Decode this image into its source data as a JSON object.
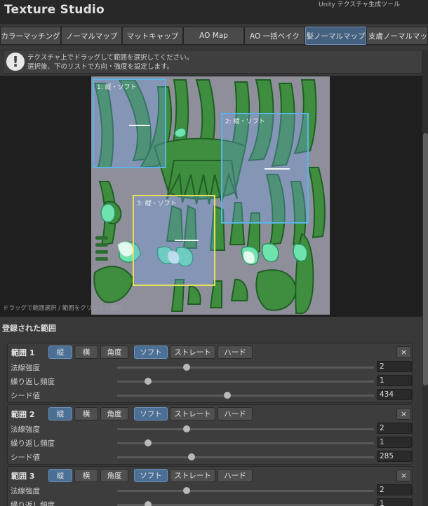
{
  "app": {
    "title": "Texture Studio",
    "subtitle": "Unity テクスチャ生成ツール"
  },
  "tabs": [
    {
      "label": "カラーマッチング",
      "active": false
    },
    {
      "label": "ノーマルマップ",
      "active": false
    },
    {
      "label": "マットキャップ",
      "active": false
    },
    {
      "label": "AO Map",
      "active": false
    },
    {
      "label": "AO 一括ベイク",
      "active": false
    },
    {
      "label": "髪ノーマルマップ",
      "active": true
    },
    {
      "label": "支膚ノーマルマッ",
      "active": false
    }
  ],
  "info": {
    "icon": "exclamation-icon",
    "line1": "テクスチャ上でドラッグして範囲を選択してください。",
    "line2": "選択後、下のリストで方向・強度を設定します。"
  },
  "preview": {
    "hint": "ドラッグで範囲選択 / 範囲をクリックで選択",
    "regions": [
      {
        "label": "1: 縦・ソフト",
        "selected": false
      },
      {
        "label": "2: 縦・ソフト",
        "selected": false
      },
      {
        "label": "3: 縦・ソフト",
        "selected": true
      }
    ]
  },
  "section_title": "登録された範囲",
  "ranges": [
    {
      "title": "範囲 1",
      "direction": {
        "vertical": "縦",
        "horizontal": "横",
        "angle": "角度",
        "selected": "縦"
      },
      "softness": {
        "soft": "ソフト",
        "straight": "ストレート",
        "hard": "ハード",
        "selected": "ソフト"
      },
      "close": "×",
      "properties": [
        {
          "label": "法線強度",
          "value": "2",
          "level": 0.27
        },
        {
          "label": "繰り返し頻度",
          "value": "1",
          "level": 0.12
        },
        {
          "label": "シード値",
          "value": "434",
          "level": 0.43
        }
      ]
    },
    {
      "title": "範囲 2",
      "direction": {
        "vertical": "縦",
        "horizontal": "横",
        "angle": "角度",
        "selected": "縦"
      },
      "softness": {
        "soft": "ソフト",
        "straight": "ストレート",
        "hard": "ハード",
        "selected": "ソフト"
      },
      "close": "×",
      "properties": [
        {
          "label": "法線強度",
          "value": "2",
          "level": 0.27
        },
        {
          "label": "繰り返し頻度",
          "value": "1",
          "level": 0.12
        },
        {
          "label": "シード値",
          "value": "285",
          "level": 0.29
        }
      ]
    },
    {
      "title": "範囲 3",
      "direction": {
        "vertical": "縦",
        "horizontal": "横",
        "angle": "角度",
        "selected": "縦"
      },
      "softness": {
        "soft": "ソフト",
        "straight": "ストレート",
        "hard": "ハード",
        "selected": "ソフト"
      },
      "close": "×",
      "properties": [
        {
          "label": "法線強度",
          "value": "2",
          "level": 0.27
        },
        {
          "label": "繰り返し頻度",
          "value": "1",
          "level": 0.12
        }
      ]
    }
  ],
  "colors": {
    "accent": "#4b6f95",
    "region_border": "#58b5e6",
    "selected_region": "#e5e05a"
  }
}
